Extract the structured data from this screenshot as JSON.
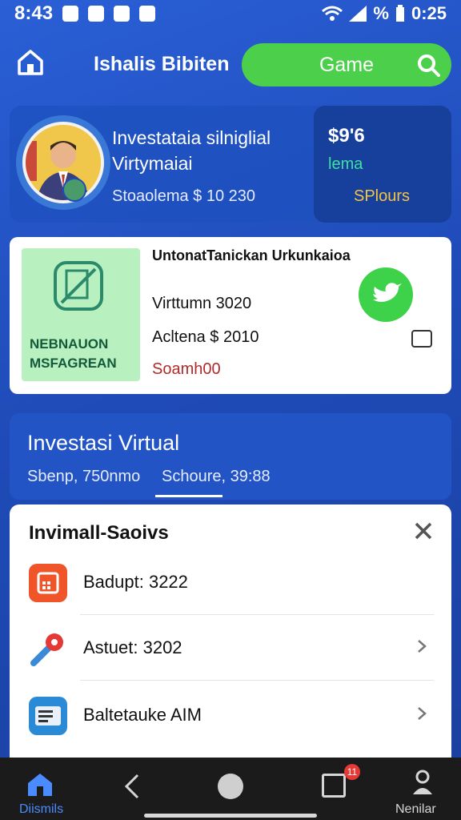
{
  "status_bar": {
    "time": "8:43",
    "battery": "0:25",
    "signal_text": "%"
  },
  "header": {
    "title": "Ishalis Bibiten",
    "game_label": "Game"
  },
  "profile_card": {
    "title": "Investataia silniglial Virtymaiai",
    "subtitle": "Stoaolema $ 10 230",
    "stat_value": "$9'6",
    "stat_label": "lema",
    "stat_link": "SPlours"
  },
  "info_card": {
    "thumb_text": "NEBNAUON MSFAGREAN",
    "title": "UntonatTanickan Urkunkaioa",
    "line1": "Virttumn 3020",
    "line2": "Acltena $ 2010",
    "link": "Soamh00"
  },
  "investment": {
    "title": "Investasi Virtual",
    "tab1": "Sbenp, 750nmo",
    "tab2": "Schoure, 39:88"
  },
  "sheet": {
    "title": "Invimall-Saoivs",
    "items": [
      {
        "label": "Badupt: 3222"
      },
      {
        "label": "Astuet: 3202"
      },
      {
        "label": "Baltetauke AIM"
      }
    ]
  },
  "bottom_nav": {
    "home_label": "Diismils",
    "profile_label": "Nenilar",
    "badge": "11"
  },
  "colors": {
    "bg": "#1f4bb8",
    "accent_green": "#4cd04c",
    "card": "#ffffff"
  }
}
